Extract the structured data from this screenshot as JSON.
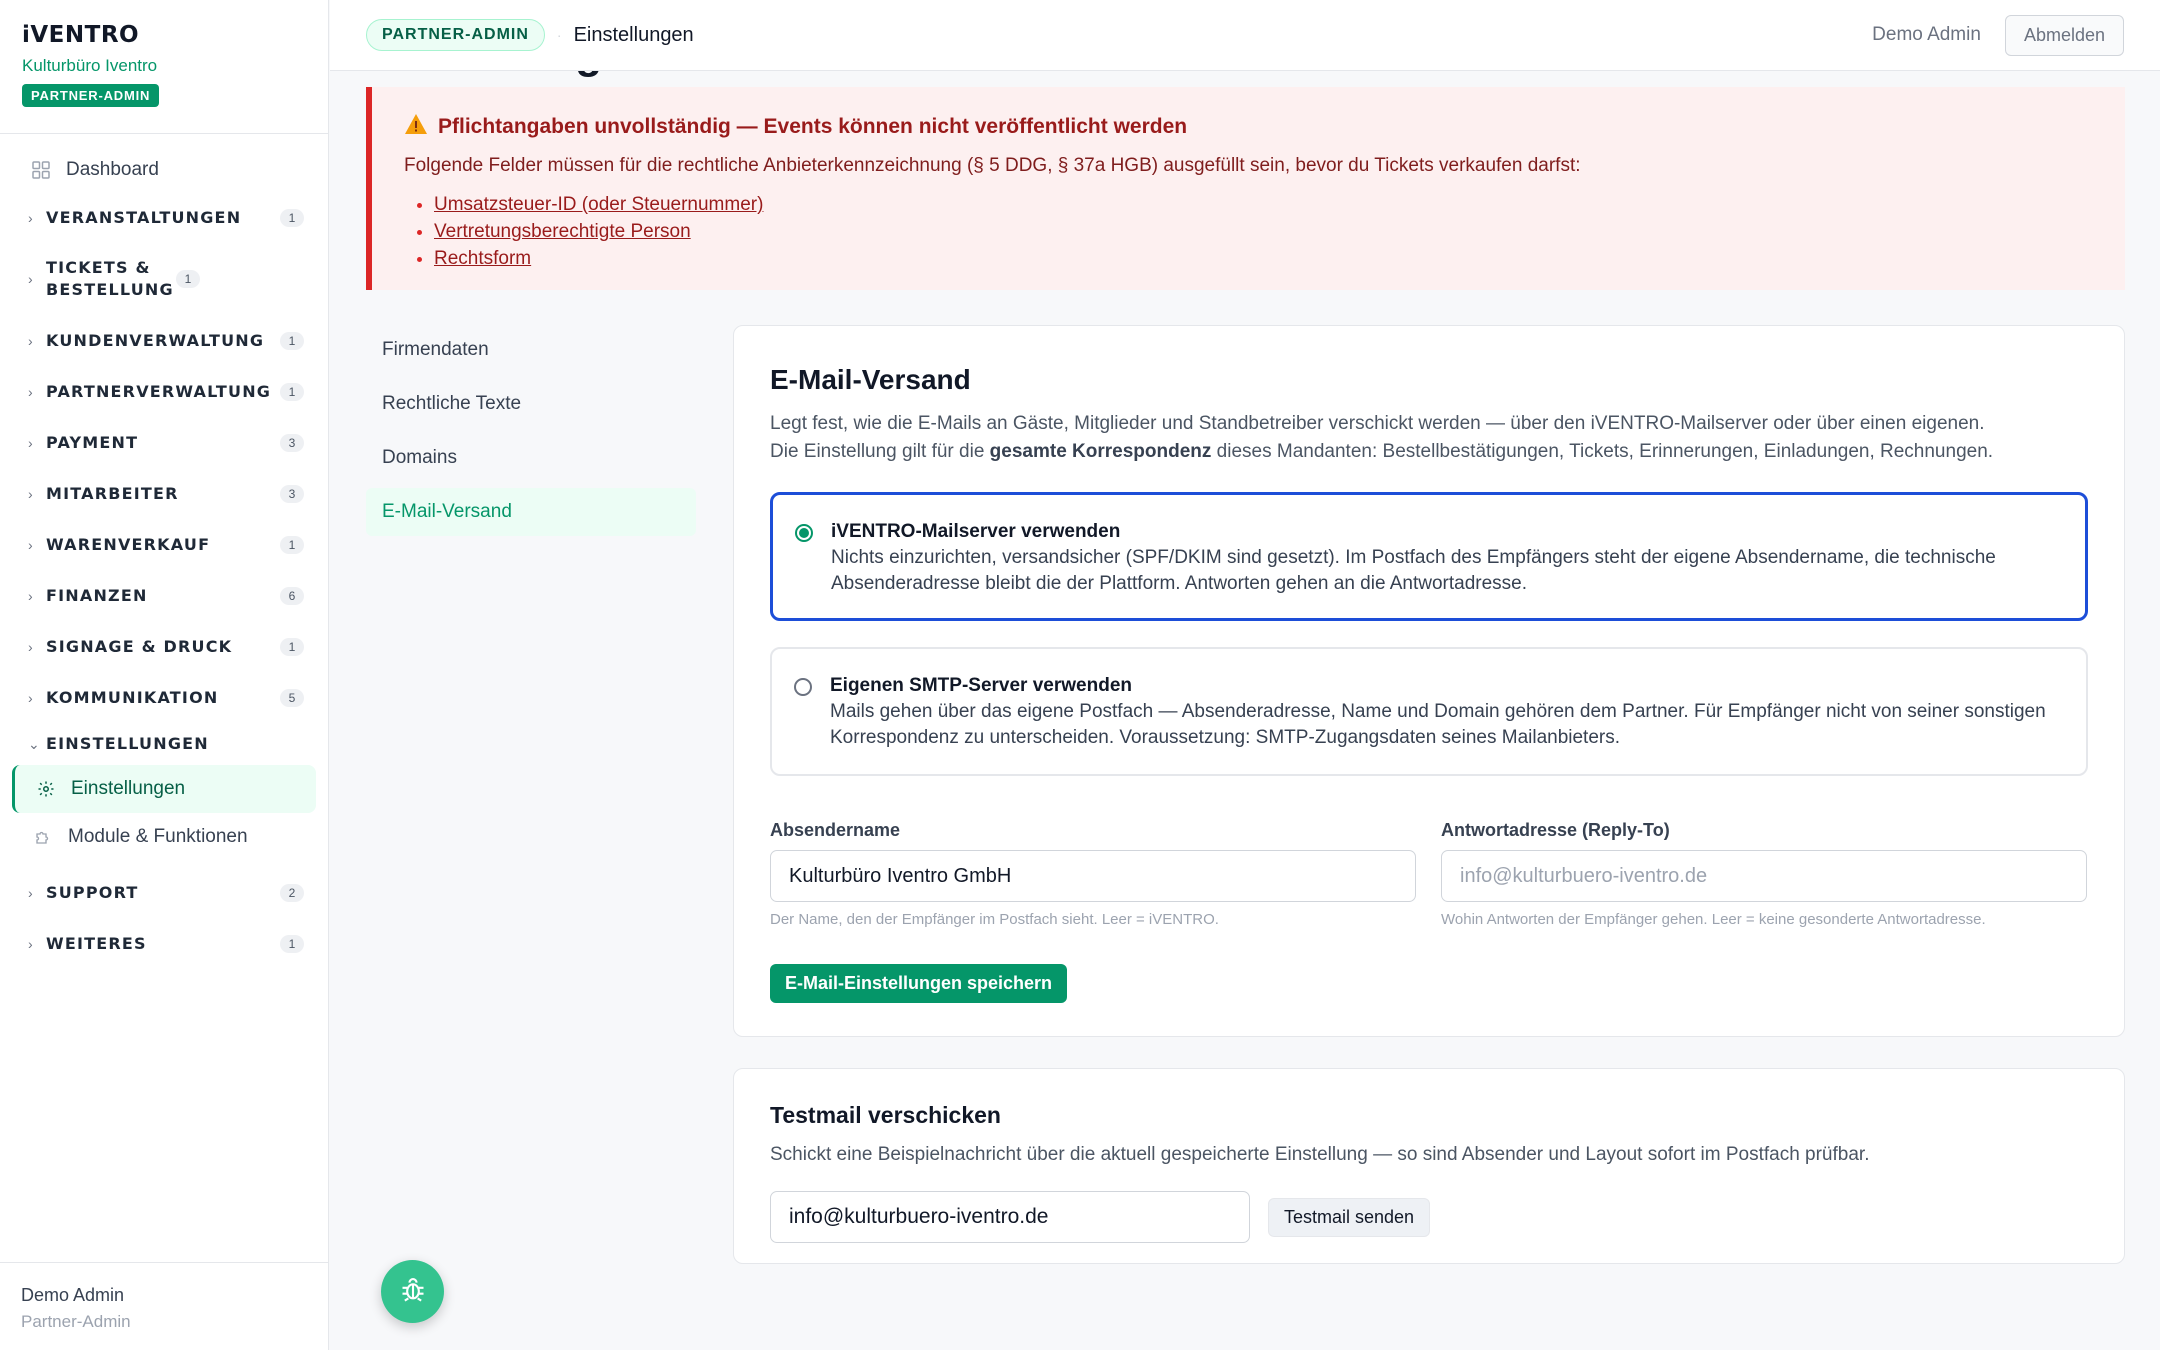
{
  "brand": {
    "logo": "iVENTRO",
    "org": "Kulturbüro Iventro",
    "role_badge": "PARTNER-ADMIN"
  },
  "sidebar": {
    "dashboard": "Dashboard",
    "groups": [
      {
        "label": "VERANSTALTUNGEN",
        "count": "1"
      },
      {
        "label": "TICKETS & BESTELLUNG",
        "count": "1"
      },
      {
        "label": "KUNDENVERWALTUNG",
        "count": "1"
      },
      {
        "label": "PARTNERVERWALTUNG",
        "count": "1"
      },
      {
        "label": "PAYMENT",
        "count": "3"
      },
      {
        "label": "MITARBEITER",
        "count": "3"
      },
      {
        "label": "WARENVERKAUF",
        "count": "1"
      },
      {
        "label": "FINANZEN",
        "count": "6"
      },
      {
        "label": "SIGNAGE & DRUCK",
        "count": "1"
      },
      {
        "label": "KOMMUNIKATION",
        "count": "5"
      },
      {
        "label": "EINSTELLUNGEN"
      },
      {
        "label": "SUPPORT",
        "count": "2"
      },
      {
        "label": "WEITERES",
        "count": "1"
      }
    ],
    "sub_items": [
      "Einstellungen",
      "Module & Funktionen"
    ],
    "footer": {
      "name": "Demo Admin",
      "role": "Partner-Admin"
    }
  },
  "topbar": {
    "pill": "PARTNER-ADMIN",
    "crumb": "Einstellungen",
    "user": "Demo Admin",
    "logout": "Abmelden"
  },
  "page": {
    "title": "Einstellungen"
  },
  "alert": {
    "title": "Pflichtangaben unvollständig — Events können nicht veröffentlicht werden",
    "text": "Folgende Felder müssen für die rechtliche Anbieterkennzeichnung (§ 5 DDG, § 37a HGB) ausgefüllt sein, bevor du Tickets verkaufen darfst:",
    "items": [
      "Umsatzsteuer-ID (oder Steuernummer)",
      "Vertretungsberechtigte Person",
      "Rechtsform"
    ]
  },
  "subnav": [
    "Firmendaten",
    "Rechtliche Texte",
    "Domains",
    "E-Mail-Versand"
  ],
  "email": {
    "title": "E-Mail-Versand",
    "desc1": "Legt fest, wie die E-Mails an Gäste, Mitglieder und Standbetreiber verschickt werden — über den iVENTRO-Mailserver oder über einen eigenen.",
    "desc2a": "Die Einstellung gilt für die ",
    "desc2b": "gesamte Korrespondenz",
    "desc2c": " dieses Mandanten: Bestellbestätigungen, Tickets, Erinnerungen, Einladungen, Rechnungen.",
    "opt1_title": "iVENTRO-Mailserver verwenden",
    "opt1_desc": "Nichts einzurichten, versandsicher (SPF/DKIM sind gesetzt). Im Postfach des Empfängers steht der eigene Absendername, die technische Absenderadresse bleibt die der Plattform. Antworten gehen an die Antwortadresse.",
    "opt2_title": "Eigenen SMTP-Server verwenden",
    "opt2_desc": "Mails gehen über das eigene Postfach — Absenderadresse, Name und Domain gehören dem Partner. Für Empfänger nicht von seiner sonstigen Korrespondenz zu unterscheiden. Voraussetzung: SMTP-Zugangsdaten seines Mailanbieters.",
    "sender_label": "Absendername",
    "sender_value": "Kulturbüro Iventro GmbH",
    "sender_hint": "Der Name, den der Empfänger im Postfach sieht. Leer = iVENTRO.",
    "reply_label": "Antwortadresse (Reply-To)",
    "reply_placeholder": "info@kulturbuero-iventro.de",
    "reply_hint": "Wohin Antworten der Empfänger gehen. Leer = keine gesonderte Antwortadresse.",
    "save": "E-Mail-Einstellungen speichern"
  },
  "test": {
    "title": "Testmail verschicken",
    "desc": "Schickt eine Beispielnachricht über die aktuell gespeicherte Einstellung — so sind Absender und Layout sofort im Postfach prüfbar.",
    "value": "info@kulturbuero-iventro.de",
    "send": "Testmail senden"
  }
}
